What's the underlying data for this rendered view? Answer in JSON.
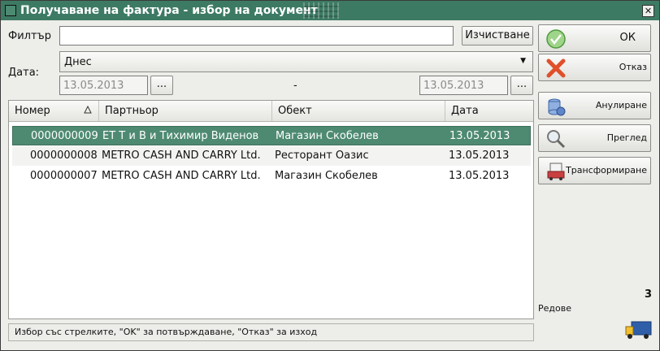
{
  "window": {
    "title": "Получаване на фактура - избор на документ"
  },
  "filter": {
    "label": "Филтър",
    "value": "",
    "clear_label": "Изчистване"
  },
  "date": {
    "label": "Дата:",
    "period": "Днес",
    "from": "13.05.2013",
    "to": "13.05.2013",
    "separator": "-",
    "picker_label": "..."
  },
  "table": {
    "columns": [
      "Номер",
      "Партньор",
      "Обект",
      "Дата"
    ],
    "rows": [
      {
        "number": "0000000009",
        "partner": "ЕТ Т и В и Тихимир Виденов",
        "site": "Магазин Скобелев",
        "date": "13.05.2013"
      },
      {
        "number": "0000000008",
        "partner": "METRO CASH AND CARRY Ltd.",
        "site": "Ресторант Оазис",
        "date": "13.05.2013"
      },
      {
        "number": "0000000007",
        "partner": "METRO CASH AND CARRY Ltd.",
        "site": "Магазин Скобелев",
        "date": "13.05.2013"
      }
    ]
  },
  "status": "Избор със стрелките, \"OK\" за потвърждаване, \"Отказ\" за изход",
  "side": {
    "ok": "ОК",
    "cancel": "Отказ",
    "annul": "Анулиране",
    "preview": "Преглед",
    "transform": "Трансформиране",
    "rows_count": "3",
    "rows_label": "Редове"
  },
  "colors": {
    "accent": "#3d7a64",
    "selection": "#4e8a72"
  }
}
